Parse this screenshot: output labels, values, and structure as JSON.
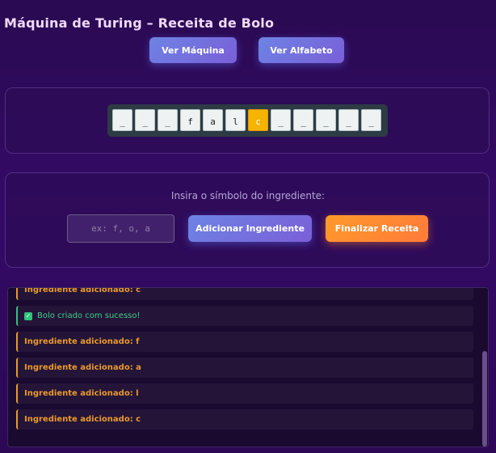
{
  "app": {
    "title": "Máquina de Turing – Receita de Bolo"
  },
  "nav": {
    "machine_label": "Ver Máquina",
    "alphabet_label": "Ver Alfabeto"
  },
  "tape": {
    "cells": [
      "_",
      "_",
      "_",
      "f",
      "a",
      "l",
      "c",
      "_",
      "_",
      "_",
      "_",
      "_"
    ],
    "head_index": 6
  },
  "input": {
    "prompt": "Insira o símbolo do ingrediente:",
    "placeholder": "ex: f, o, a",
    "add_label": "Adicionar Ingrediente",
    "finish_label": "Finalizar Receita"
  },
  "log": {
    "entries": [
      {
        "type": "ingredient",
        "text": "Ingrediente adicionado: c"
      },
      {
        "type": "success",
        "text": "Bolo criado com sucesso!",
        "icon": "check-icon"
      },
      {
        "type": "ingredient",
        "text": "Ingrediente adicionado: f"
      },
      {
        "type": "ingredient",
        "text": "Ingrediente adicionado: a"
      },
      {
        "type": "ingredient",
        "text": "Ingrediente adicionado: l"
      },
      {
        "type": "ingredient",
        "text": "Ingrediente adicionado: c"
      }
    ]
  },
  "colors": {
    "accent_blue": "#6d83e3",
    "accent_orange": "#ff9a2b",
    "head_cell": "#f5b400",
    "success": "#31c27c",
    "log_ingredient": "#e99a2c"
  }
}
